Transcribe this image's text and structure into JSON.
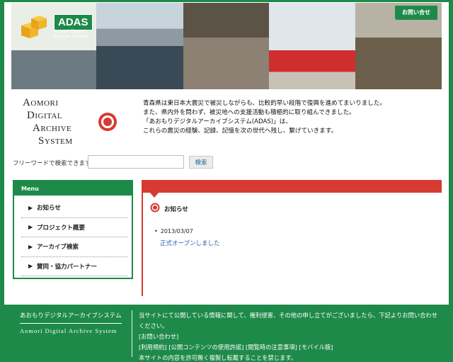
{
  "header": {
    "logo_badge": "ADAS",
    "logo_sub_line1": "Aomori Digital",
    "logo_sub_line2": "Archive System",
    "contact_label": "お問い合せ"
  },
  "system_title": {
    "line1": "Aomori",
    "line2": "Digital",
    "line3": "Archive",
    "line4": "System"
  },
  "intro": {
    "line1": "青森県は東日本大震災で被災しながらも、比較的早い段階で復興を進めてまいりました。",
    "line2": "また、県内外を問わず、被災地への支援活動も積極的に取り組んできました。",
    "line3": "「あおもりデジタルアーカイブシステム(ADAS)」は、",
    "line4": "これらの震災の経験、記録、記憶を次の世代へ残し、繋げていきます。"
  },
  "search": {
    "label": "フリーワードで検索できます",
    "value": "",
    "placeholder": "",
    "button_label": "検索"
  },
  "menu": {
    "title": "Menu",
    "items": [
      {
        "label": "お知らせ"
      },
      {
        "label": "プロジェクト概要"
      },
      {
        "label": "アーカイブ検索"
      },
      {
        "label": "賛同・協力パートナー"
      }
    ]
  },
  "news": {
    "title": "お知らせ",
    "entries": [
      {
        "date": "2013/03/07",
        "text": "正式オープンしました"
      }
    ]
  },
  "footer": {
    "name_jp": "あおもりデジタルアーカイブシステム",
    "name_en": "Aomori Digital Archive System",
    "line1": "当サイトにて公開している情報に関して、権利侵害、その他の申し立てがございましたら、下記よりお問い合わせください。",
    "line2": "[お問い合わせ]",
    "line3": "[利用規約]  [公開コンテンツの使用許諾]  [閲覧時の注意事項]  [モバイル版]",
    "line4": "本サイトの内容を許可無く複製し転載することを禁じます。"
  },
  "colors": {
    "brand_green": "#1e8a4a",
    "accent_red": "#d63a32",
    "link_blue": "#2a5ea9"
  },
  "icons": {
    "logo": "stacked-cubes-icon",
    "title_mark": "red-target-icon",
    "menu_bullet": "triangle-right-icon",
    "news_mark": "red-target-icon"
  }
}
